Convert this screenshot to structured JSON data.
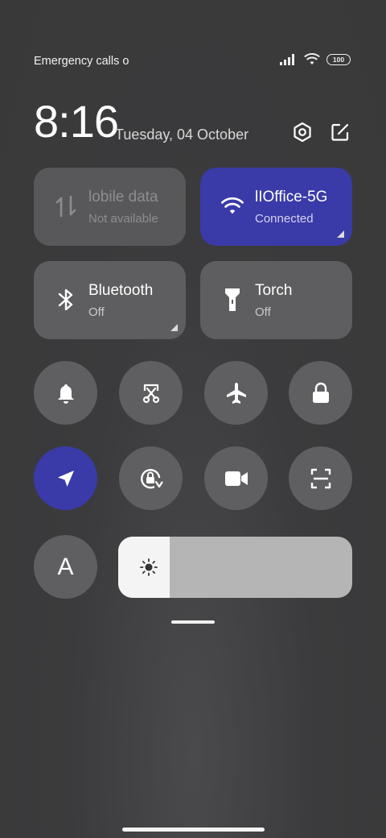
{
  "status_bar": {
    "carrier_text": "Emergency calls o",
    "battery": "100"
  },
  "header": {
    "time": "8:16",
    "date": "Tuesday, 04 October",
    "settings_icon": "settings-gear-icon",
    "edit_icon": "edit-icon"
  },
  "tiles": {
    "mobile_data": {
      "name": "lobile data",
      "state": "Not available",
      "icon": "mobile-data-icon"
    },
    "wifi": {
      "name": "lIOffice-5G",
      "state": "Connected",
      "icon": "wifi-icon"
    },
    "bluetooth": {
      "name": "Bluetooth",
      "state": "Off",
      "icon": "bluetooth-icon"
    },
    "torch": {
      "name": "Torch",
      "state": "Off",
      "icon": "torch-icon"
    }
  },
  "toggles_row1": [
    "bell-icon",
    "screenshot-icon",
    "airplane-icon",
    "lock-icon"
  ],
  "toggles_row2": [
    "location-icon",
    "rotation-lock-icon",
    "screen-record-icon",
    "scanner-icon"
  ],
  "font_button": {
    "label": "A"
  },
  "brightness": {
    "level": 0.22,
    "icon": "sun-icon"
  },
  "colors": {
    "accent": "#3a3aa8",
    "tile": "#5e5e60",
    "button": "#5f5f61"
  }
}
